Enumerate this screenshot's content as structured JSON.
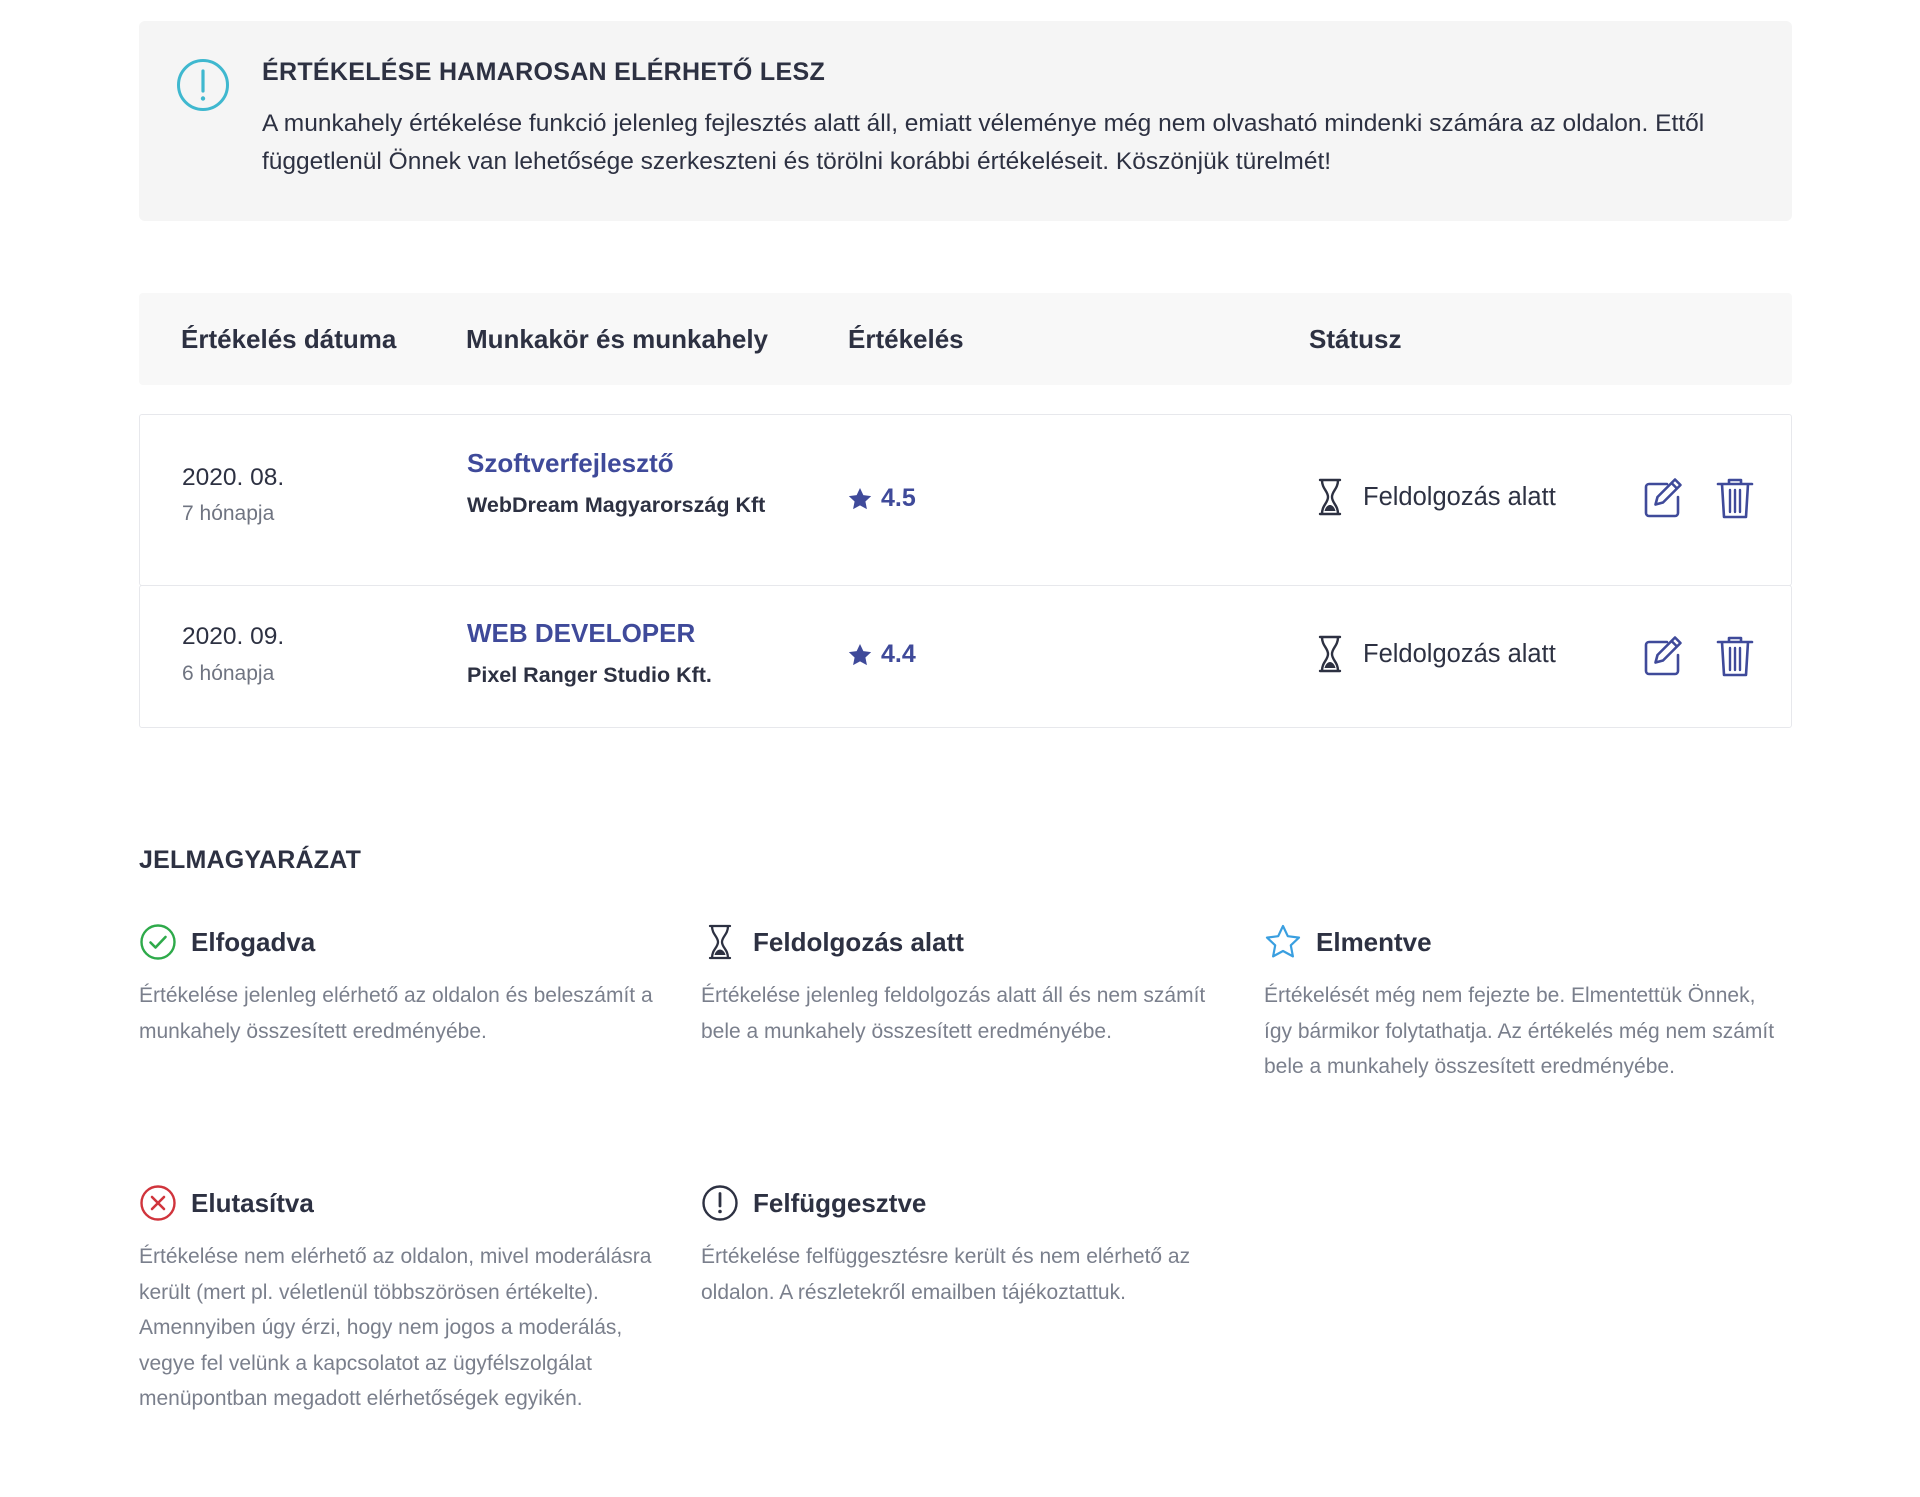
{
  "notice": {
    "icon": "exclamation-circle-icon",
    "title": "ÉRTÉKELÉSE HAMAROSAN ELÉRHETŐ LESZ",
    "text": "A munkahely értékelése funkció jelenleg fejlesztés alatt áll, emiatt véleménye még nem olvasható mindenki számára az oldalon. Ettől függetlenül Önnek van lehetősége szerkeszteni és törölni korábbi értékeléseit. Köszönjük türelmét!"
  },
  "table": {
    "headers": {
      "date": "Értékelés dátuma",
      "job": "Munkakör és munkahely",
      "rating": "Értékelés",
      "status": "Státusz"
    },
    "rows": [
      {
        "date": "2020. 08.",
        "ago": "7 hónapja",
        "job_title": "Szoftverfejlesztő",
        "company": "WebDream Magyarország Kft",
        "rating": "4.5",
        "status": "Feldolgozás alatt"
      },
      {
        "date": "2020. 09.",
        "ago": "6 hónapja",
        "job_title": "WEB DEVELOPER",
        "company": "Pixel Ranger Studio Kft.",
        "rating": "4.4",
        "status": "Feldolgozás alatt"
      }
    ]
  },
  "legend": {
    "title": "JELMAGYARÁZAT",
    "items": [
      {
        "icon": "check-circle-icon",
        "label": "Elfogadva",
        "desc": "Értékelése jelenleg elérhető az oldalon és beleszámít a munkahely összesített eredményébe."
      },
      {
        "icon": "hourglass-icon",
        "label": "Feldolgozás alatt",
        "desc": "Értékelése jelenleg feldolgozás alatt áll és nem számít bele a munkahely összesített eredményébe."
      },
      {
        "icon": "star-outline-icon",
        "label": "Elmentve",
        "desc": "Értékelését még nem fejezte be. Elmentettük Önnek, így bármikor folytathatja. Az értékelés még nem számít bele a munkahely összesített eredményébe."
      },
      {
        "icon": "x-circle-icon",
        "label": "Elutasítva",
        "desc": "Értékelése nem elérhető az oldalon, mivel moderálásra került (mert pl. véletlenül többszörösen értékelte). Amennyiben úgy érzi, hogy nem jogos a moderálás, vegye fel velünk a kapcsolatot az ügyfélszolgálat menüpontban megadott elérhetőségek egyikén."
      },
      {
        "icon": "exclamation-circle-icon",
        "label": "Felfüggesztve",
        "desc": "Értékelése felfüggesztésre került és nem elérhető az oldalon. A részletekről emailben tájékoztattuk."
      }
    ]
  },
  "colors": {
    "accent": "#3f4a9a",
    "notice_icon": "#3fb8cf",
    "success": "#2eaa4a",
    "danger": "#d0343c",
    "saved": "#3a9fe0",
    "text": "#2d3142",
    "muted": "#7a7f8c"
  }
}
